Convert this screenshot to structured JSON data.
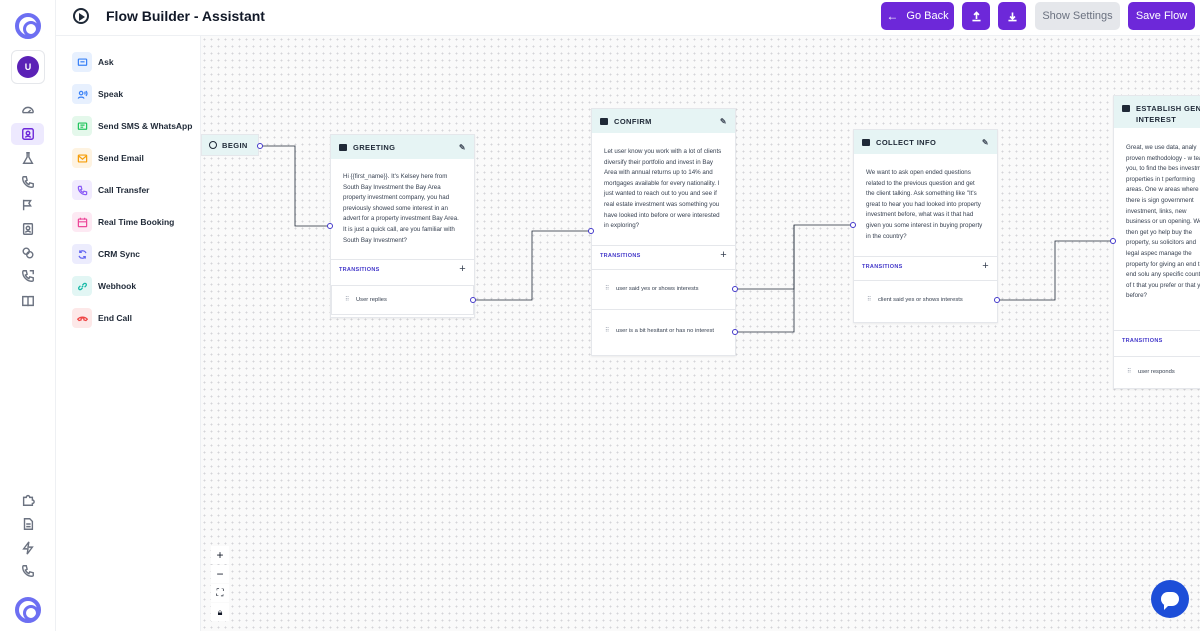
{
  "header": {
    "title": "Flow Builder - Assistant",
    "go_back": "Go Back",
    "show_settings": "Show Settings",
    "save_flow": "Save Flow",
    "upload_icon": "upload-icon",
    "download_icon": "download-icon"
  },
  "user": {
    "initial": "U"
  },
  "components": [
    {
      "label": "Ask",
      "icon": "chat-icon",
      "color": "#3b82f6"
    },
    {
      "label": "Speak",
      "icon": "speak-icon",
      "color": "#3b82f6"
    },
    {
      "label": "Send SMS & WhatsApp",
      "icon": "sms-icon",
      "color": "#22c55e"
    },
    {
      "label": "Send Email",
      "icon": "mail-icon",
      "color": "#f59e0b"
    },
    {
      "label": "Call Transfer",
      "icon": "phone-transfer-icon",
      "color": "#8b5cf6"
    },
    {
      "label": "Real Time Booking",
      "icon": "calendar-icon",
      "color": "#ec4899"
    },
    {
      "label": "CRM Sync",
      "icon": "sync-icon",
      "color": "#6366f1"
    },
    {
      "label": "Webhook",
      "icon": "link-icon",
      "color": "#14b8a6"
    },
    {
      "label": "End Call",
      "icon": "end-call-icon",
      "color": "#ef4444"
    }
  ],
  "canvas": {
    "begin_label": "BEGIN",
    "transitions_label": "TRANSITIONS",
    "nodes": [
      {
        "title": "GREETING",
        "body": "Hi {{first_name}}. It's Kelsey here from South Bay Investment the Bay Area property investment company, you had previously showed some interest in an advert for a property investment Bay Area. It is just a quick call, are you familiar with South Bay Investment?",
        "transitions": [
          "User replies"
        ]
      },
      {
        "title": "CONFIRM",
        "body": "Let user know you work with a lot of clients diversify their portfolio and invest in Bay Area with annual returns up to 14% and mortgages available for every nationality. I just wanted to reach out to you and see if real estate investment was something you have looked into before or were interested in exploring?",
        "transitions": [
          "user said yes or shows interests",
          "user is a bit hesitant or has no interest"
        ]
      },
      {
        "title": "COLLECT INFO",
        "body": "We want to ask open ended questions related to the previous question and get the client talking. Ask something like \"It's great to hear you had looked into property investment before, what was it that had given you some interest in buying property in the country?",
        "transitions": [
          "client said yes or shows interests"
        ]
      },
      {
        "title": "ESTABLISH GENU INTEREST",
        "body": "Great, we use data, analy proven methodology - w teach you, to find the bes investment properties in t performing areas. One w areas where there is sign government investment, links, new business or un opening. We then get yo help buy the property, su solicitors and legal aspec manage the property for giving an end to end solu any specific counties of t that you prefer or that yo before?",
        "transitions": [
          "user responds"
        ]
      }
    ]
  }
}
